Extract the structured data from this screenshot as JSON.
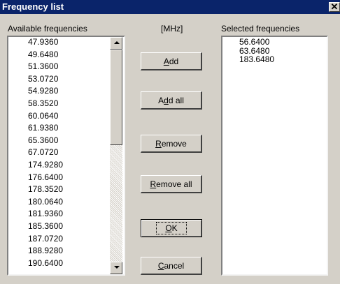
{
  "window": {
    "title": "Frequency list",
    "close_glyph": "✕"
  },
  "labels": {
    "available": "Available frequencies",
    "unit": "[MHz]",
    "selected": "Selected frequencies"
  },
  "available": [
    "47.9360",
    "49.6480",
    "51.3600",
    "53.0720",
    "54.9280",
    "58.3520",
    "60.0640",
    "61.9380",
    "65.3600",
    "67.0720",
    "174.9280",
    "176.6400",
    "178.3520",
    "180.0640",
    "181.9360",
    "185.3600",
    "187.0720",
    "188.9280",
    "190.6400"
  ],
  "selected": [
    "56.6400",
    "63.6480",
    "183.6480"
  ],
  "buttons": {
    "add": {
      "pre": "",
      "key": "A",
      "post": "dd"
    },
    "add_all": {
      "pre": "A",
      "key": "d",
      "post": "d all"
    },
    "remove": {
      "pre": "",
      "key": "R",
      "post": "emove"
    },
    "remove_all": {
      "pre": "",
      "key": "R",
      "post": "emove all"
    },
    "ok": {
      "pre": "",
      "key": "O",
      "post": "K"
    },
    "cancel": {
      "pre": "",
      "key": "C",
      "post": "ancel"
    }
  },
  "scrollbar": {
    "position": 0.0,
    "visible_fraction": 0.45
  },
  "colors": {
    "titlebar": "#0a246a",
    "face": "#d4d0c8",
    "list_bg": "#ffffff"
  }
}
